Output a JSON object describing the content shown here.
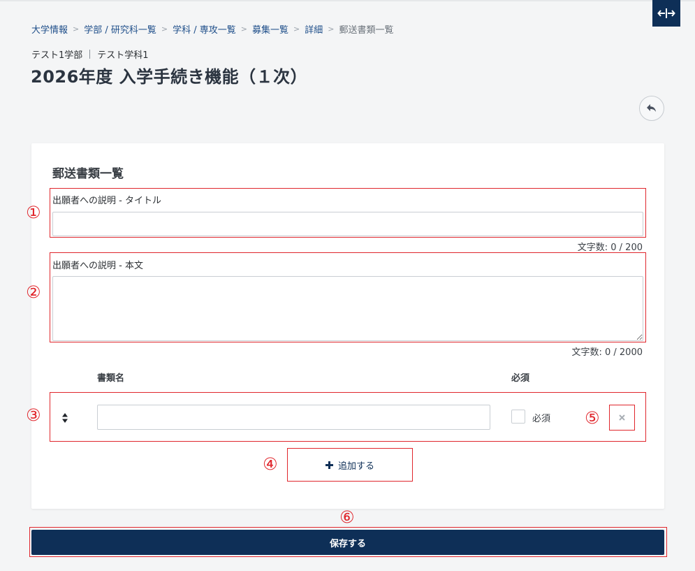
{
  "breadcrumb": {
    "links": [
      "大学情報",
      "学部 / 研究科一覧",
      "学科 / 専攻一覧",
      "募集一覧",
      "詳細"
    ],
    "current": "郵送書類一覧",
    "separator": ">"
  },
  "header": {
    "faculty": "テスト1学部",
    "department": "テスト学科1",
    "title": "2026年度 入学手続き機能（１次）"
  },
  "section": {
    "title": "郵送書類一覧"
  },
  "fields": {
    "title_field": {
      "label": "出願者への説明 - タイトル",
      "value": "",
      "counter": "文字数: 0 / 200"
    },
    "body_field": {
      "label": "出願者への説明 - 本文",
      "value": "",
      "counter": "文字数: 0 / 2000"
    }
  },
  "document_table": {
    "headers": {
      "name": "書類名",
      "required": "必須"
    },
    "rows": [
      {
        "name": "",
        "required": false,
        "required_label": "必須"
      }
    ]
  },
  "actions": {
    "add_label": "追加する",
    "save_label": "保存する"
  },
  "markers": [
    "①",
    "②",
    "③",
    "④",
    "⑤",
    "⑥"
  ],
  "icons": {
    "expand": "expand-horizontal-icon",
    "back": "undo-arrow-icon",
    "sort": "sort-icon",
    "delete": "close-icon",
    "add": "plus-icon"
  },
  "colors": {
    "primary": "#0e2f57",
    "link": "#1f4f8a",
    "annotation": "#e0262c",
    "background": "#f4f5f6"
  }
}
